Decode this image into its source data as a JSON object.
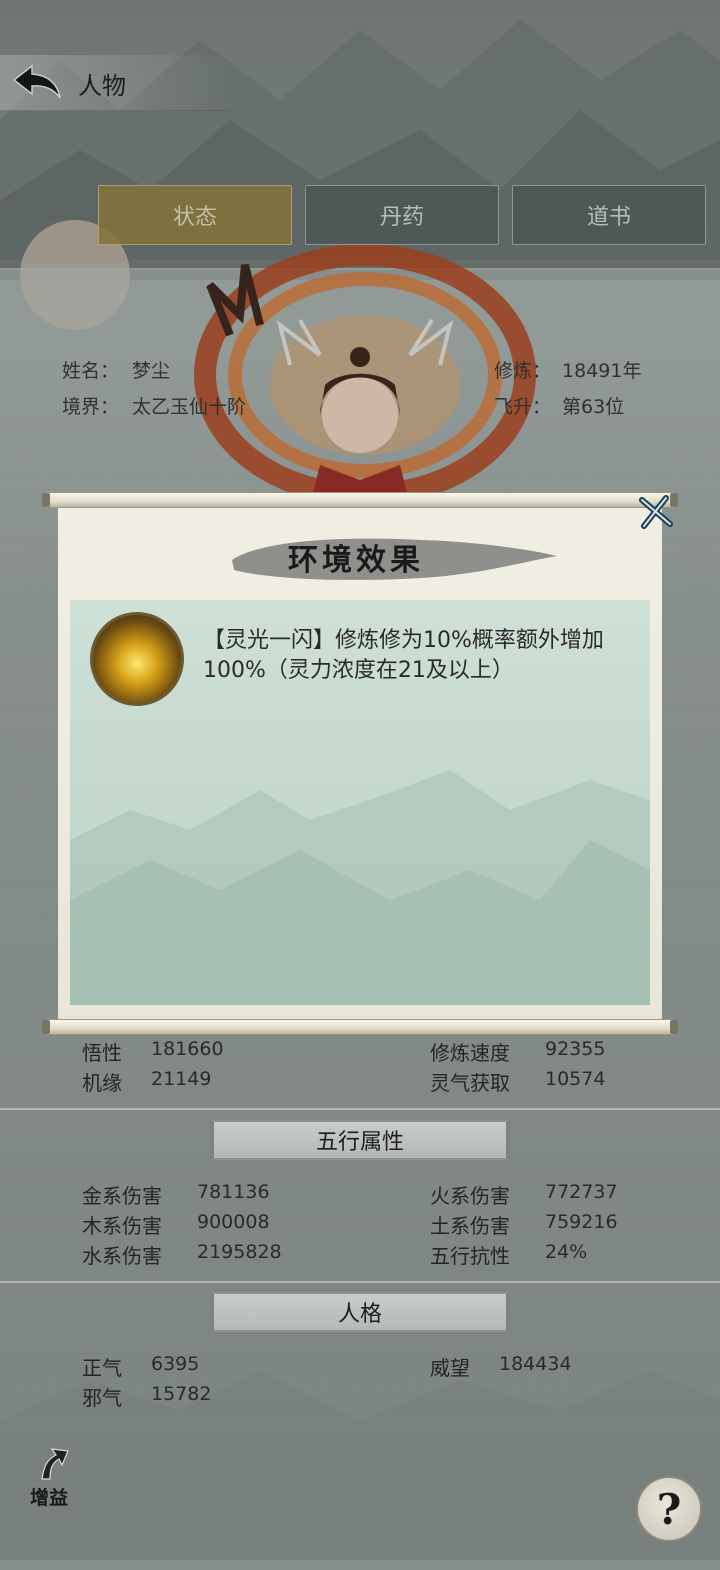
{
  "header": {
    "title": "人物",
    "back_icon": "back-arrow-icon"
  },
  "tabs": [
    {
      "label": "状态",
      "active": true
    },
    {
      "label": "丹药",
      "active": false
    },
    {
      "label": "道书",
      "active": false
    }
  ],
  "character": {
    "name_label": "姓名：",
    "name": "梦尘",
    "realm_label": "境界：",
    "realm": "太乙玉仙十阶",
    "cultivation_label": "修炼：",
    "cultivation": "18491年",
    "ascension_label": "飞升：",
    "ascension": "第63位"
  },
  "stats_basic": [
    {
      "label": "悟性",
      "value": "181660"
    },
    {
      "label": "修炼速度",
      "value": "92355"
    },
    {
      "label": "机缘",
      "value": "21149"
    },
    {
      "label": "灵气获取",
      "value": "10574"
    }
  ],
  "wuxing": {
    "title": "五行属性",
    "rows": [
      {
        "label": "金系伤害",
        "value": "781136"
      },
      {
        "label": "火系伤害",
        "value": "772737"
      },
      {
        "label": "木系伤害",
        "value": "900008"
      },
      {
        "label": "土系伤害",
        "value": "759216"
      },
      {
        "label": "水系伤害",
        "value": "2195828"
      },
      {
        "label": "五行抗性",
        "value": "24%"
      }
    ]
  },
  "personality": {
    "title": "人格",
    "rows": [
      {
        "label": "正气",
        "value": "6395"
      },
      {
        "label": "威望",
        "value": "184434"
      },
      {
        "label": "邪气",
        "value": "15782"
      }
    ]
  },
  "modal": {
    "title": "环境效果",
    "effect_text": "【灵光一闪】修炼修为10%概率额外增加100%（灵力浓度在21及以上）",
    "close_icon": "close-x-icon",
    "effect_icon": "golden-light-icon"
  },
  "bottom": {
    "buff_label": "增益",
    "help_label": "?"
  },
  "colors": {
    "active_tab": "#968236",
    "content_bg": "#c8dad0",
    "scroll_paper": "#efece0"
  }
}
